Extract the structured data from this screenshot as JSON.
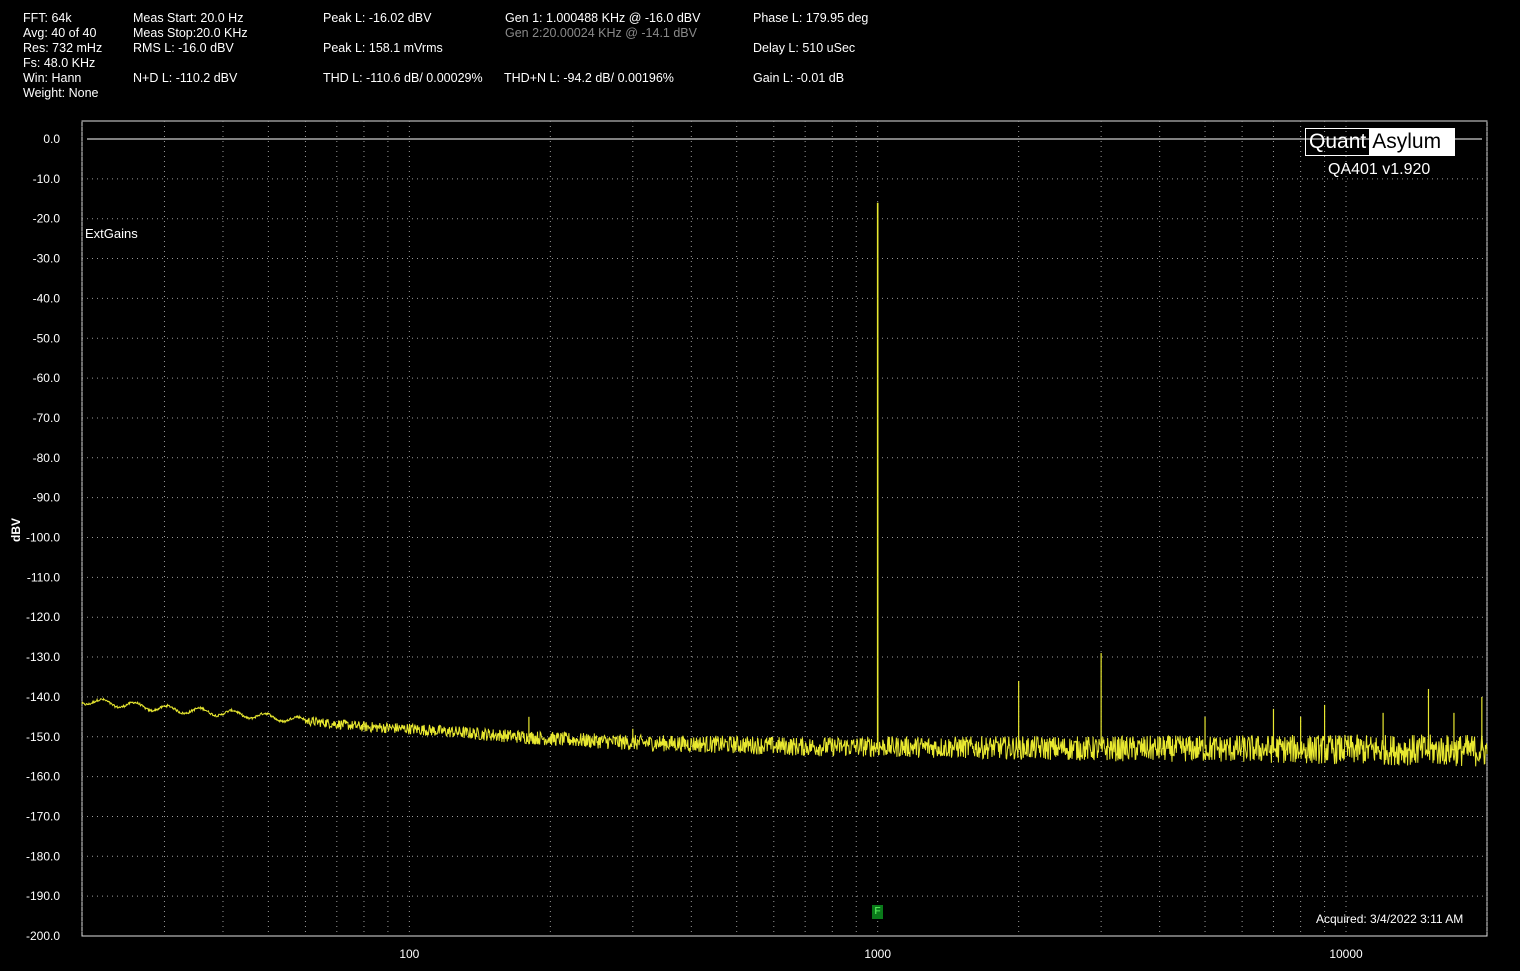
{
  "header": {
    "fft": "FFT: 64k",
    "avg": "Avg: 40 of 40",
    "res": "Res: 732 mHz",
    "fs": "Fs: 48.0 KHz",
    "win": "Win: Hann",
    "weight": "Weight: None",
    "meas_start": "Meas Start: 20.0 Hz",
    "meas_stop": "Meas Stop:20.0 KHz",
    "rms": "RMS L: -16.0 dBV",
    "nd": "N+D L: -110.2 dBV",
    "peak_dbv": "Peak L: -16.02 dBV",
    "peak_mv": "Peak L: 158.1 mVrms",
    "thd": "THD L: -110.6 dB/ 0.00029%",
    "gen1": "Gen 1: 1.000488 KHz @ -16.0  dBV",
    "gen2": "Gen 2:20.00024 KHz @ -14.1  dBV",
    "thdn": "THD+N L: -94.2 dB/ 0.00196%",
    "phase": "Phase L: 179.95 deg",
    "delay": "Delay L: 510 uSec",
    "gain": "Gain L: -0.01 dB"
  },
  "logo": {
    "part1": "Quant",
    "part2": "Asylum",
    "version": "QA401 v1.920"
  },
  "annotations": {
    "extgains": "ExtGains",
    "acquired": "Acquired: 3/4/2022  3:11 AM",
    "marker": "F"
  },
  "colors": {
    "background": "#000000",
    "trace": "#e8e830",
    "grid": "#9a9a9a"
  },
  "chart_data": {
    "type": "line",
    "xscale": "log",
    "xlim": [
      20,
      20000
    ],
    "ylim": [
      -200,
      0
    ],
    "ylabel": "dBV",
    "xlabel": "",
    "grid": true,
    "x_ticks": [
      100,
      1000,
      10000
    ],
    "x_tick_labels": [
      "100",
      "1000",
      "10000"
    ],
    "y_ticks": [
      0,
      -10,
      -20,
      -30,
      -40,
      -50,
      -60,
      -70,
      -80,
      -90,
      -100,
      -110,
      -120,
      -130,
      -140,
      -150,
      -160,
      -170,
      -180,
      -190,
      -200
    ],
    "y_tick_labels": [
      "0.0",
      "-10.0",
      "-20.0",
      "-30.0",
      "-40.0",
      "-50.0",
      "-60.0",
      "-70.0",
      "-80.0",
      "-90.0",
      "-100.0",
      "-110.0",
      "-120.0",
      "-130.0",
      "-140.0",
      "-150.0",
      "-160.0",
      "-170.0",
      "-180.0",
      "-190.0",
      "-200.0"
    ],
    "series": [
      {
        "floor": {
          "x": [
            20,
            25,
            30,
            40,
            50,
            60,
            80,
            100,
            150,
            200,
            300,
            500,
            700,
            1000,
            2000,
            3000,
            5000,
            10000,
            20000
          ],
          "y": [
            -141,
            -142,
            -143,
            -144,
            -145,
            -146,
            -147.5,
            -148,
            -149.5,
            -150.5,
            -151.5,
            -152,
            -152.5,
            -152.5,
            -152.8,
            -153,
            -153,
            -153.2,
            -153.5
          ]
        },
        "peaks": {
          "x": [
            180,
            300,
            1000,
            2000,
            3000,
            4000,
            5000,
            7000,
            8000,
            9000,
            12000,
            15000,
            17000,
            19500
          ],
          "y": [
            -145,
            -148,
            -16,
            -136,
            -129,
            -150,
            -145,
            -143,
            -145,
            -142,
            -144,
            -138,
            -144,
            -140
          ]
        }
      }
    ]
  }
}
